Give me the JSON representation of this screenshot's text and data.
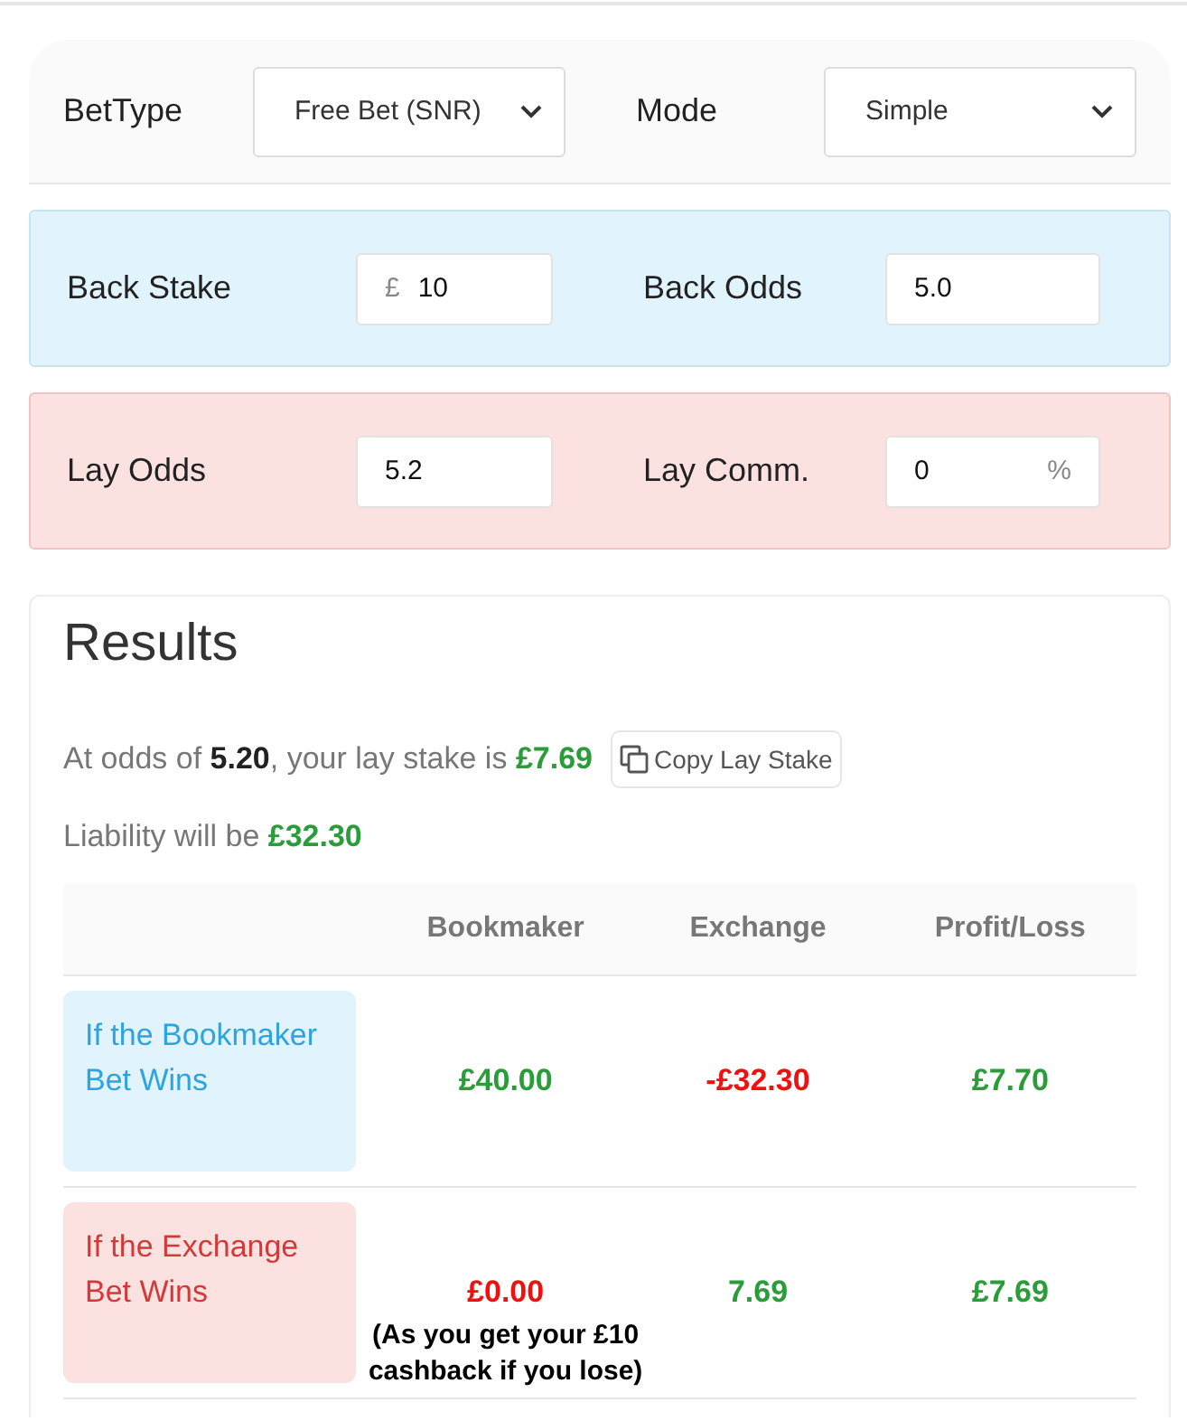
{
  "settings": [
    {
      "label": "BetType",
      "value": "Free Bet (SNR)"
    },
    {
      "label": "Mode",
      "value": "Simple"
    }
  ],
  "panels": [
    {
      "kind": "back",
      "fields": [
        {
          "label": "Back Stake",
          "prefix": "£",
          "value": "10"
        },
        {
          "label": "Back Odds",
          "value": "5.0"
        }
      ]
    },
    {
      "kind": "lay",
      "fields": [
        {
          "label": "Lay Odds",
          "value": "5.2"
        },
        {
          "label": "Lay Comm.",
          "value": "0",
          "suffix": "%"
        }
      ]
    }
  ],
  "results": {
    "title": "Results",
    "summary": {
      "lead": "At odds of ",
      "odds": "5.20",
      "middle": ", your lay stake is ",
      "stake": "£7.69"
    },
    "copy_button": "Copy Lay Stake",
    "liability": {
      "lead": "Liability will be ",
      "amount": "£32.30"
    },
    "columns": [
      "Bookmaker",
      "Exchange",
      "Profit/Loss"
    ],
    "rows": [
      {
        "kind": "back",
        "label": "If the Bookmaker Bet Wins",
        "cells": [
          {
            "value": "£40.00",
            "color": "#2a9d3a"
          },
          {
            "value": "-£32.30",
            "color": "#f01010"
          },
          {
            "value": "£7.70",
            "color": "#2a9d3a"
          }
        ]
      },
      {
        "kind": "lay",
        "label": "If the Exchange Bet Wins",
        "cells": [
          {
            "value": "£0.00",
            "color": "#f01010"
          },
          {
            "value": "7.69",
            "color": "#2a9d3a"
          },
          {
            "value": "£7.69",
            "color": "#2a9d3a"
          }
        ],
        "note": "(As you get your £10 cashback if you lose)"
      }
    ]
  }
}
